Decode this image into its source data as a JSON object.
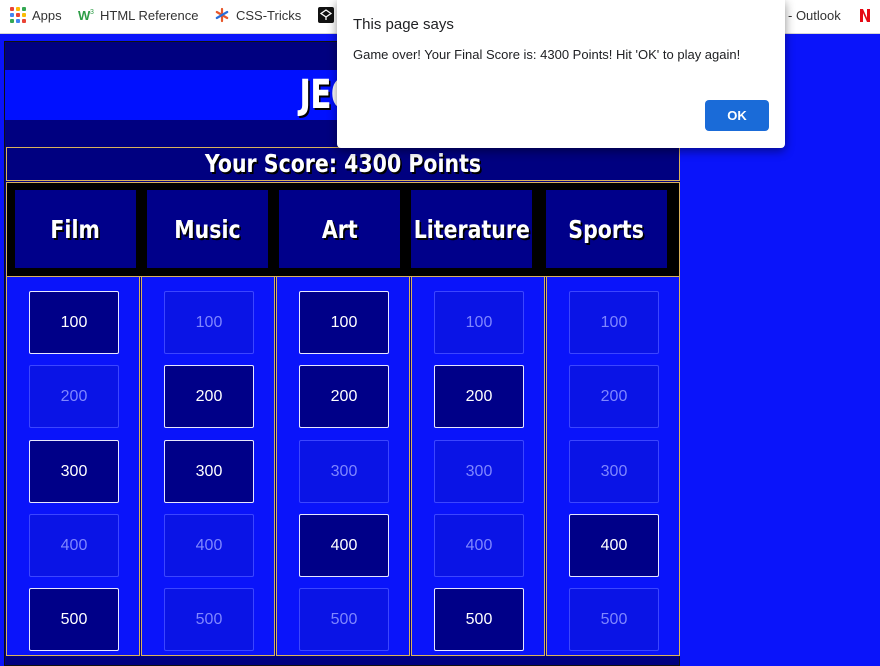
{
  "bookmarks": [
    {
      "label": "Apps",
      "icon": "apps-grid-icon"
    },
    {
      "label": "HTML Reference",
      "icon": "w3schools-icon"
    },
    {
      "label": "CSS-Tricks",
      "icon": "css-tricks-icon"
    },
    {
      "label": "",
      "icon": "codepen-icon"
    },
    {
      "label": "- Outlook",
      "icon": "outlook-icon"
    },
    {
      "label": "",
      "icon": "netflix-icon"
    }
  ],
  "game": {
    "title": "JEOP",
    "score_text": "Your Score: 4300 Points",
    "categories": [
      "Film",
      "Music",
      "Art",
      "Literature",
      "Sports"
    ],
    "columns": [
      [
        {
          "value": "100",
          "state": "active"
        },
        {
          "value": "200",
          "state": "used"
        },
        {
          "value": "300",
          "state": "active"
        },
        {
          "value": "400",
          "state": "used"
        },
        {
          "value": "500",
          "state": "active"
        }
      ],
      [
        {
          "value": "100",
          "state": "used"
        },
        {
          "value": "200",
          "state": "active"
        },
        {
          "value": "300",
          "state": "active"
        },
        {
          "value": "400",
          "state": "used"
        },
        {
          "value": "500",
          "state": "used"
        }
      ],
      [
        {
          "value": "100",
          "state": "active"
        },
        {
          "value": "200",
          "state": "active"
        },
        {
          "value": "300",
          "state": "used"
        },
        {
          "value": "400",
          "state": "active"
        },
        {
          "value": "500",
          "state": "used"
        }
      ],
      [
        {
          "value": "100",
          "state": "used"
        },
        {
          "value": "200",
          "state": "active"
        },
        {
          "value": "300",
          "state": "used"
        },
        {
          "value": "400",
          "state": "used"
        },
        {
          "value": "500",
          "state": "active"
        }
      ],
      [
        {
          "value": "100",
          "state": "used"
        },
        {
          "value": "200",
          "state": "used"
        },
        {
          "value": "300",
          "state": "used"
        },
        {
          "value": "400",
          "state": "active"
        },
        {
          "value": "500",
          "state": "used"
        }
      ]
    ]
  },
  "dialog": {
    "title": "This page says",
    "message": "Game over! Your Final Score is: 4300 Points! Hit 'OK' to play again!",
    "ok_label": "OK"
  },
  "colors": {
    "page_bg": "#0a14fa",
    "board_bg": "#000080",
    "border_gold": "#d9b25c",
    "ok_button": "#1a6bd8"
  }
}
